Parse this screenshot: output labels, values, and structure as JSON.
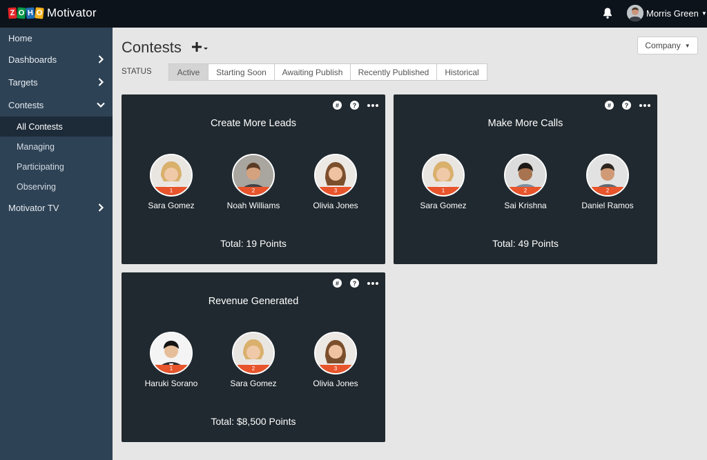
{
  "app": {
    "logo_letters": [
      "Z",
      "O",
      "H",
      "O"
    ],
    "logo_colors": [
      "#e42527",
      "#089949",
      "#226db4",
      "#f9b21d"
    ],
    "name": "Motivator"
  },
  "user": {
    "name": "Morris Green"
  },
  "sidebar": {
    "items": [
      {
        "label": "Home"
      },
      {
        "label": "Dashboards"
      },
      {
        "label": "Targets"
      },
      {
        "label": "Contests"
      },
      {
        "label": "Motivator TV"
      }
    ],
    "contests_sub": [
      {
        "label": "All Contests"
      },
      {
        "label": "Managing"
      },
      {
        "label": "Participating"
      },
      {
        "label": "Observing"
      }
    ]
  },
  "main": {
    "title": "Contests",
    "company_label": "Company",
    "status_label": "STATUS",
    "tabs": [
      {
        "label": "Active"
      },
      {
        "label": "Starting Soon"
      },
      {
        "label": "Awaiting Publish"
      },
      {
        "label": "Recently Published"
      },
      {
        "label": "Historical"
      }
    ]
  },
  "cards": [
    {
      "title": "Create More Leads",
      "hash": "#",
      "help": "?",
      "participants": [
        {
          "name": "Sara Gomez",
          "rank": "1"
        },
        {
          "name": "Noah Williams",
          "rank": "2"
        },
        {
          "name": "Olivia Jones",
          "rank": "3"
        }
      ],
      "total": "Total: 19 Points"
    },
    {
      "title": "Make More Calls",
      "hash": "#",
      "help": "?",
      "participants": [
        {
          "name": "Sara Gomez",
          "rank": "1"
        },
        {
          "name": "Sai Krishna",
          "rank": "2"
        },
        {
          "name": "Daniel Ramos",
          "rank": "2"
        }
      ],
      "total": "Total: 49 Points"
    },
    {
      "title": "Revenue Generated",
      "hash": "#",
      "help": "?",
      "participants": [
        {
          "name": "Haruki Sorano",
          "rank": "1"
        },
        {
          "name": "Sara Gomez",
          "rank": "2"
        },
        {
          "name": "Olivia Jones",
          "rank": "3"
        }
      ],
      "total": "Total: $8,500 Points"
    }
  ],
  "colors": {
    "topbar": "#0d131b",
    "sidebar": "#2e4255",
    "card": "#20292f",
    "rank_badge": "#e8542b",
    "background": "#e6e6e6"
  }
}
